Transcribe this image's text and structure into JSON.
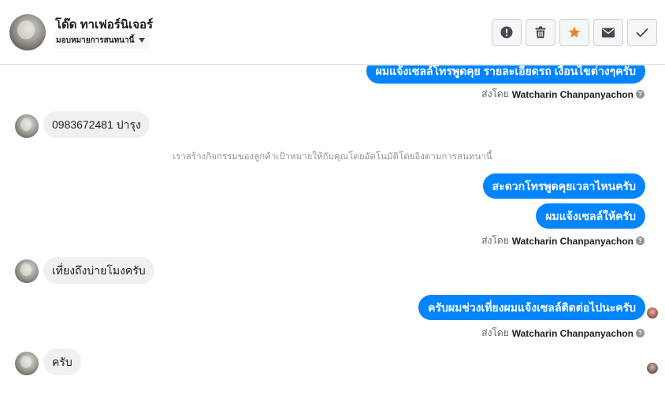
{
  "header": {
    "contact_name": "โด๊ด ทาเฟอร์นิเจอร์",
    "assign_label": "มอบหมายการสนทนานี้"
  },
  "actions": [
    {
      "icon": "alert-icon",
      "color": "#444950"
    },
    {
      "icon": "trash-icon",
      "color": "#444950"
    },
    {
      "icon": "star-icon",
      "color": "#f5811f"
    },
    {
      "icon": "envelope-icon",
      "color": "#444950"
    },
    {
      "icon": "checkmark-icon",
      "color": "#444950"
    }
  ],
  "messages": {
    "out_1": "ผมแจ้งเซลล์โทรพูดคุย รายละเอียดรถ เงื่อนไขต่างๆครับ",
    "sent_by_prefix": "ส่งโดย",
    "sent_by_name": "Watcharin Chanpanyachon",
    "in_1": "0983672481 ปารุง",
    "system_note": "เราสร้างกิจกรรมของลูกค้าเป้าหมายให้กับคุณโดยอัตโนมัติโดยอิงตามการสนทนานี้",
    "out_2": "สะดวกโทรพูดคุยเวลาไหนครับ",
    "out_3": "ผมแจ้งเซลล์ให้ครับ",
    "in_2": "เที่ยงถึงบ่ายโมงครับ",
    "out_4": "ครับผมช่วงเที่ยงผมแจ้งเซลล์ติดต่อไปนะครับ",
    "in_3": "ครับ",
    "help_glyph": "?"
  },
  "colors": {
    "outgoing_bubble": "#0084ff",
    "incoming_bubble": "#f1f0f0"
  }
}
